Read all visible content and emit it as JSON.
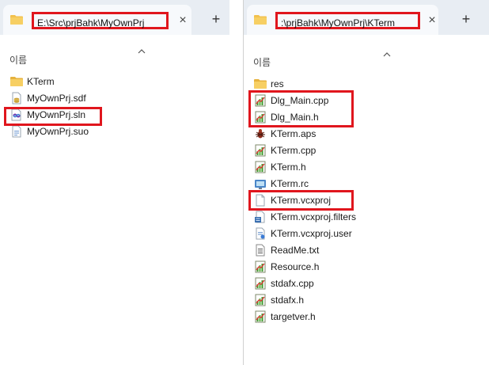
{
  "colors": {
    "highlight": "#e0161d",
    "folder": "#f2c14e",
    "tabbar": "#e8edf3"
  },
  "left_window": {
    "tab": {
      "title": "E:\\Src\\prjBahk\\MyOwnPrj",
      "close_icon": "×",
      "add_icon": "+"
    },
    "column_header": "이름",
    "files": [
      {
        "name": "KTerm",
        "icon": "folder-icon"
      },
      {
        "name": "MyOwnPrj.sdf",
        "icon": "sdf-file-icon"
      },
      {
        "name": "MyOwnPrj.sln",
        "icon": "solution-file-icon"
      },
      {
        "name": "MyOwnPrj.suo",
        "icon": "suo-file-icon"
      }
    ]
  },
  "right_window": {
    "tab": {
      "title": ":\\prjBahk\\MyOwnPrj\\KTerm",
      "close_icon": "×",
      "add_icon": "+"
    },
    "column_header": "이름",
    "files": [
      {
        "name": "res",
        "icon": "folder-icon"
      },
      {
        "name": "Dlg_Main.cpp",
        "icon": "cpp-file-icon"
      },
      {
        "name": "Dlg_Main.h",
        "icon": "header-file-icon"
      },
      {
        "name": "KTerm.aps",
        "icon": "aps-file-icon"
      },
      {
        "name": "KTerm.cpp",
        "icon": "cpp-file-icon"
      },
      {
        "name": "KTerm.h",
        "icon": "header-file-icon"
      },
      {
        "name": "KTerm.rc",
        "icon": "rc-file-icon"
      },
      {
        "name": "KTerm.vcxproj",
        "icon": "blank-file-icon"
      },
      {
        "name": "KTerm.vcxproj.filters",
        "icon": "filters-file-icon"
      },
      {
        "name": "KTerm.vcxproj.user",
        "icon": "user-file-icon"
      },
      {
        "name": "ReadMe.txt",
        "icon": "text-file-icon"
      },
      {
        "name": "Resource.h",
        "icon": "header-file-icon"
      },
      {
        "name": "stdafx.cpp",
        "icon": "cpp-file-icon"
      },
      {
        "name": "stdafx.h",
        "icon": "header-file-icon"
      },
      {
        "name": "targetver.h",
        "icon": "header-file-icon"
      }
    ]
  }
}
